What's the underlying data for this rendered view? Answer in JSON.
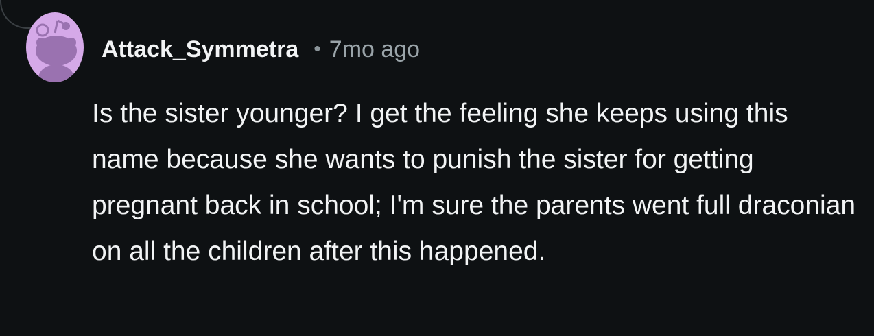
{
  "comment": {
    "author": "Attack_Symmetra",
    "separator": "•",
    "timestamp": "7mo ago",
    "body": "Is the sister younger? I get the feeling she keeps using this name because she wants to punish the sister for getting pregnant back in school; I'm sure the parents went full draconian on all the children after this happened.",
    "avatar": {
      "icon": "snoo-avatar-icon",
      "background_color": "#d5a9e8",
      "figure_color": "#9a72b0"
    }
  },
  "colors": {
    "background": "#0e1113",
    "text": "#f2f4f5",
    "muted": "#9aa4a9"
  }
}
